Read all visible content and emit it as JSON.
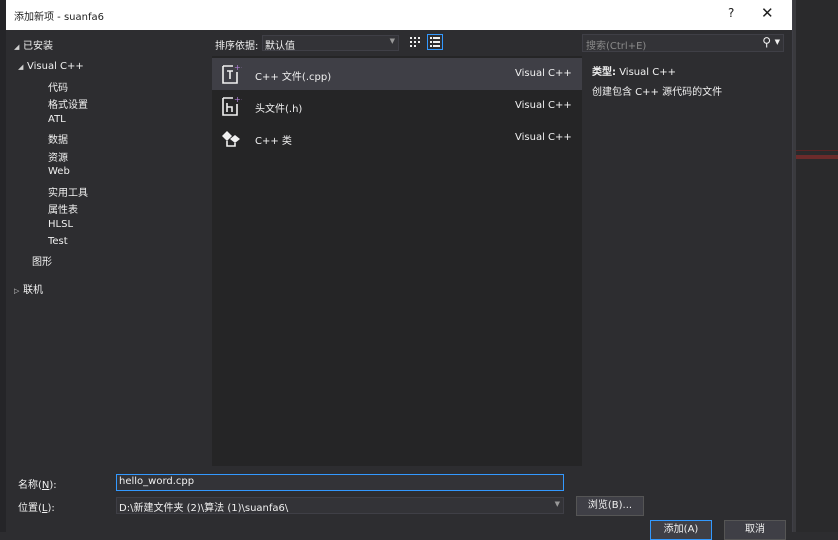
{
  "window": {
    "title": "添加新项 - suanfa6",
    "help": "?",
    "close": "✕"
  },
  "tree": {
    "installed": "已安装",
    "visual_cpp": "Visual C++",
    "children": [
      "代码",
      "格式设置",
      "ATL",
      "数据",
      "资源",
      "Web",
      "实用工具",
      "属性表",
      "HLSL",
      "Test"
    ],
    "graphics": "图形",
    "online": "联机"
  },
  "sort": {
    "label": "排序依据:",
    "value": "默认值"
  },
  "items": [
    {
      "name": "C++ 文件(.cpp)",
      "lang": "Visual C++",
      "icon": "cpp-file-icon",
      "selected": true
    },
    {
      "name": "头文件(.h)",
      "lang": "Visual C++",
      "icon": "header-file-icon",
      "selected": false
    },
    {
      "name": "C++ 类",
      "lang": "Visual C++",
      "icon": "cpp-class-icon",
      "selected": false
    }
  ],
  "search": {
    "placeholder": "搜索(Ctrl+E)"
  },
  "description": {
    "type_label": "类型:",
    "type_value": "Visual C++",
    "text": "创建包含 C++ 源代码的文件"
  },
  "bottom": {
    "name_label": "名称(",
    "name_key": "N",
    "name_suffix": "):",
    "name_value": "hello_word.cpp",
    "location_label": "位置(",
    "location_key": "L",
    "location_suffix": "):",
    "location_value": "D:\\新建文件夹 (2)\\算法 (1)\\suanfa6\\",
    "browse": "浏览(B)...",
    "add": "添加(A)",
    "cancel": "取消"
  },
  "colors": {
    "accent": "#3399ff",
    "icon_purple": "#b180d7"
  }
}
